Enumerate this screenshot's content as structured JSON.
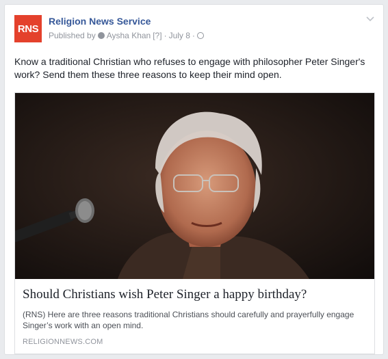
{
  "post": {
    "logo_text": "RNS",
    "page_name": "Religion News Service",
    "published_by_label": "Published by",
    "author": "Aysha Khan",
    "author_help": "[?]",
    "date": "July 8",
    "separator": "·",
    "text": "Know a traditional Christian who refuses to engage with philosopher Peter Singer's work? Send them these three reasons to keep their mind open."
  },
  "link_preview": {
    "title": "Should Christians wish Peter Singer a happy birthday?",
    "description": "(RNS) Here are three reasons traditional Christians should carefully and prayerfully engage Singer’s work with an open mind.",
    "domain": "RELIGIONNEWS.COM"
  },
  "colors": {
    "brand_logo": "#e4412c",
    "link_blue": "#365899",
    "meta_gray": "#90949c"
  }
}
